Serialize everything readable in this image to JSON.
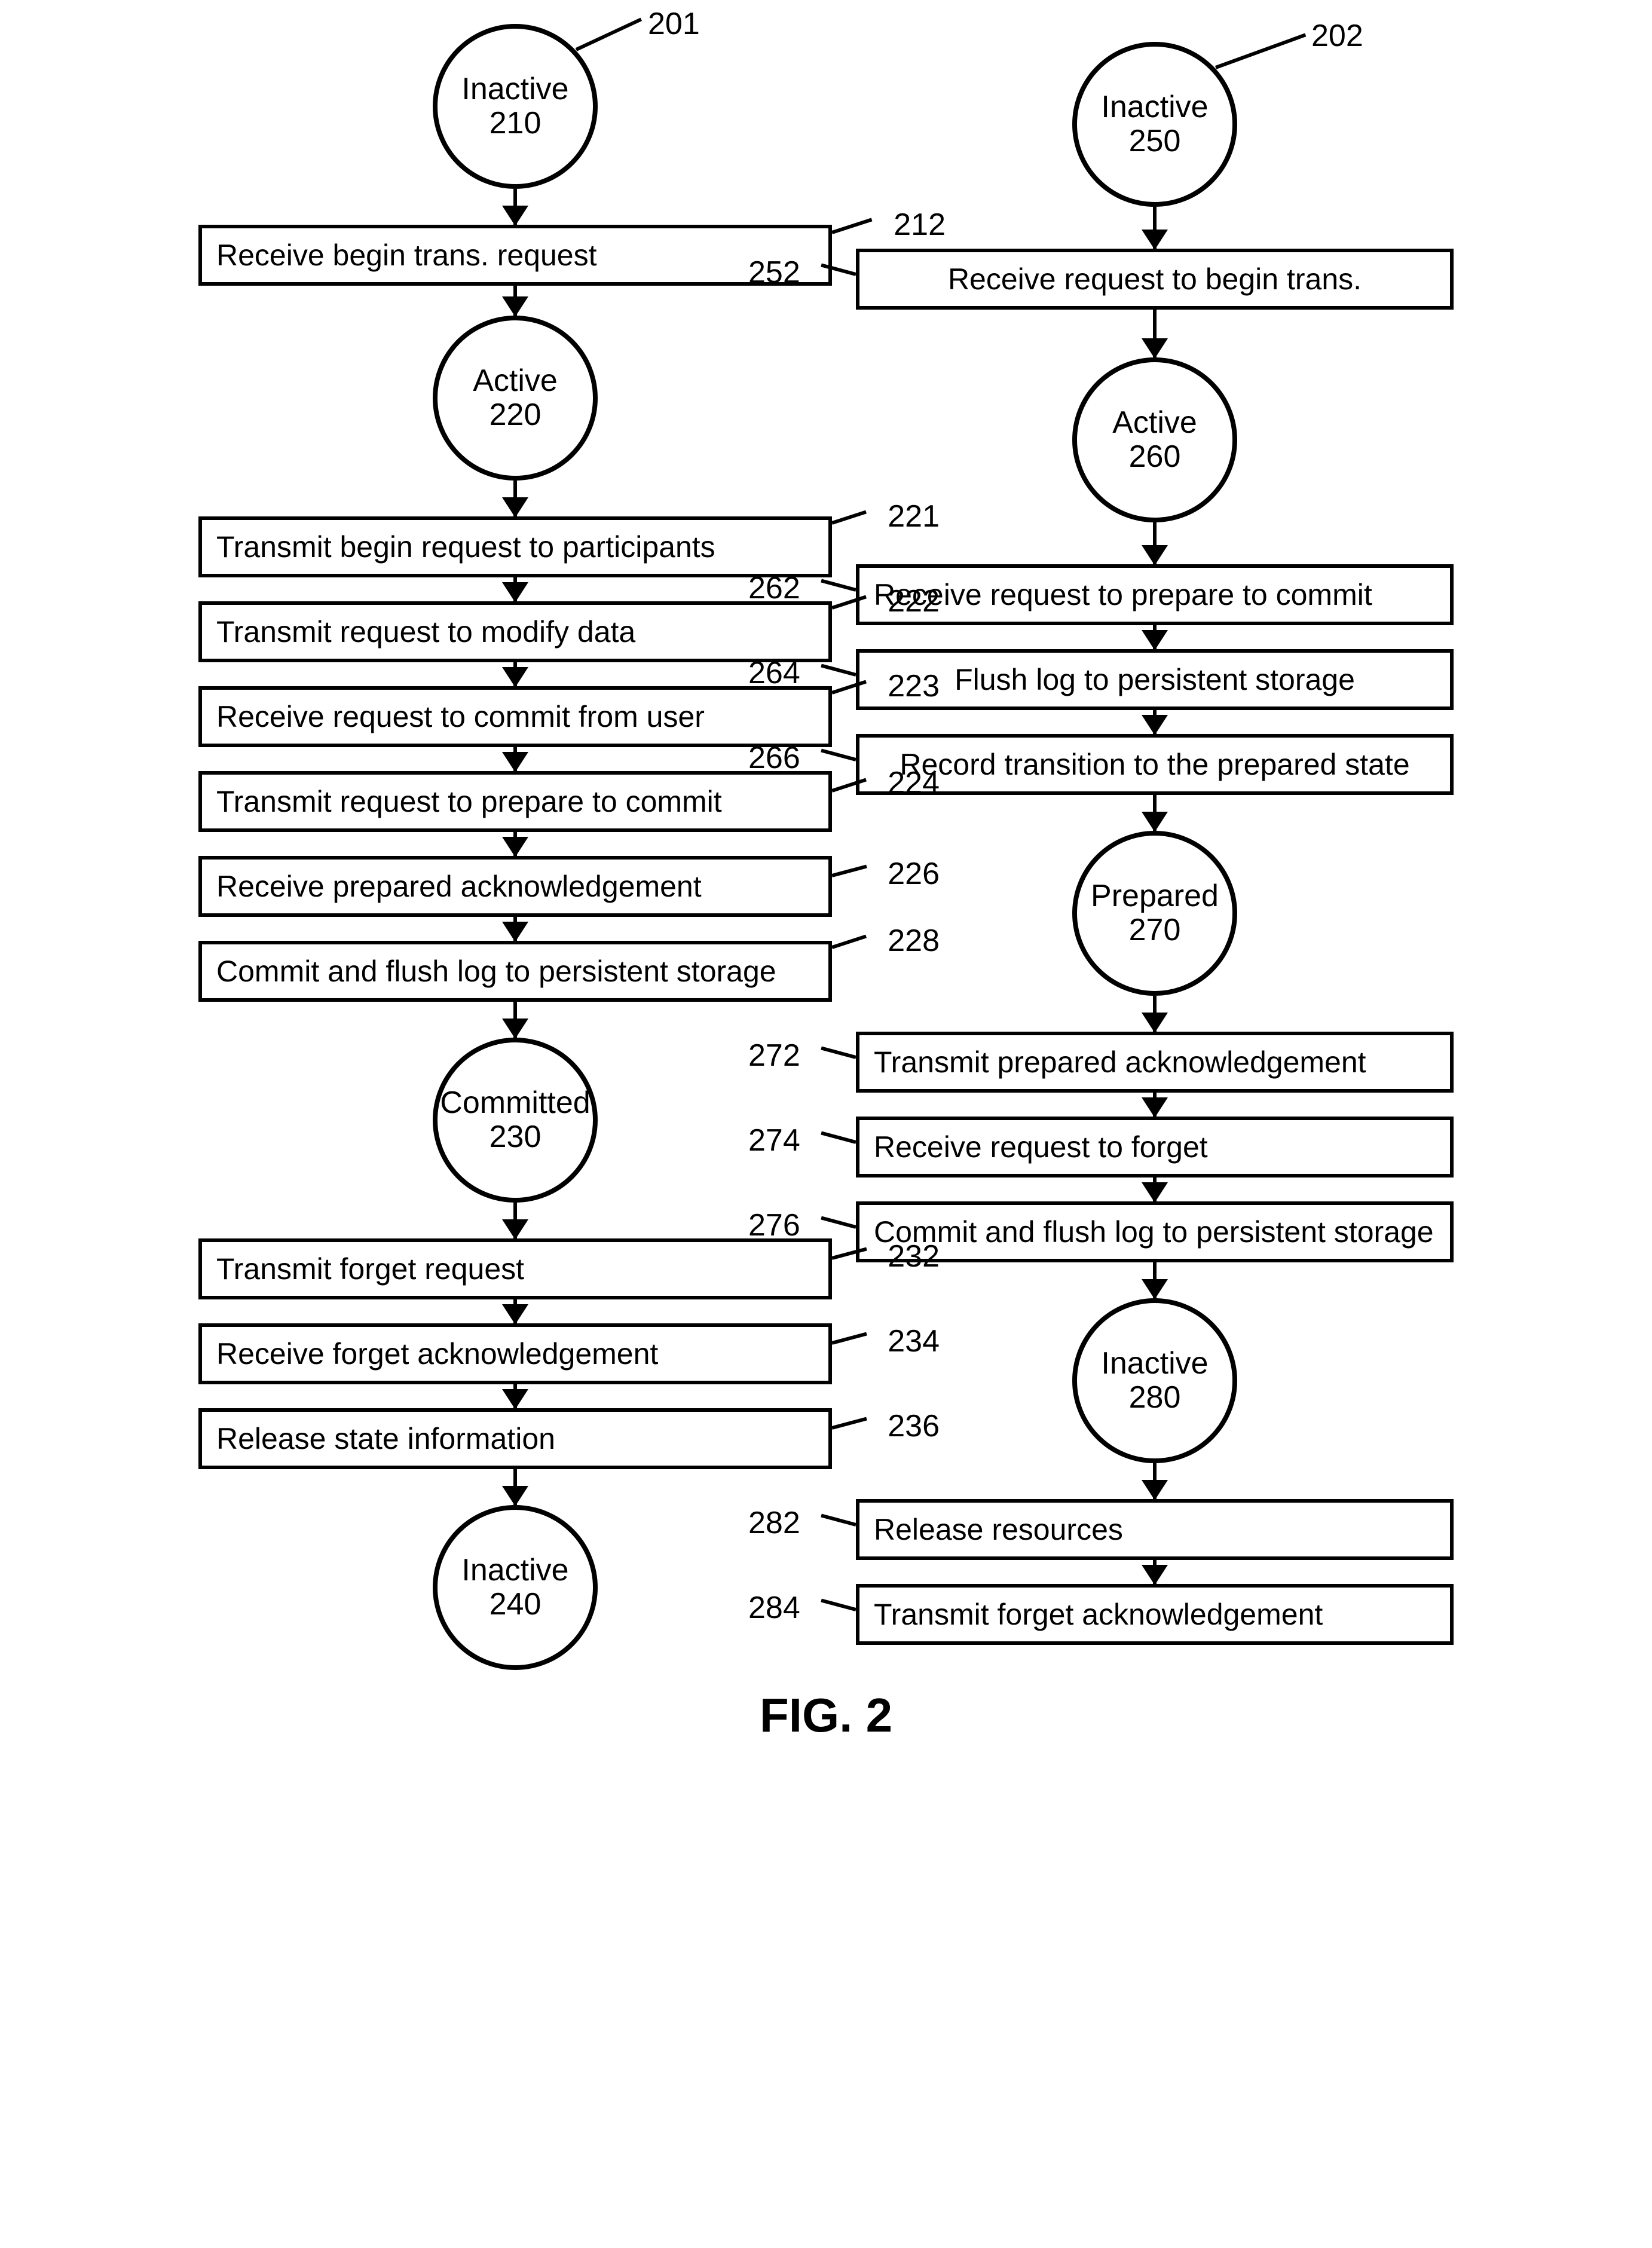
{
  "figure_label": "FIG. 2",
  "left": {
    "ref_top": "201",
    "state_inactive1": {
      "label": "Inactive",
      "num": "210"
    },
    "step212": {
      "text": "Receive begin trans. request",
      "ref": "212"
    },
    "state_active": {
      "label": "Active",
      "num": "220"
    },
    "step221": {
      "text": "Transmit begin request to participants",
      "ref": "221"
    },
    "step222": {
      "text": "Transmit request to modify data",
      "ref": "222"
    },
    "step223": {
      "text": "Receive request to commit from user",
      "ref": "223"
    },
    "step224": {
      "text": "Transmit request to prepare to commit",
      "ref": "224"
    },
    "step226": {
      "text": "Receive prepared acknowledgement",
      "ref": "226"
    },
    "step228": {
      "text": "Commit and flush log to persistent storage",
      "ref": "228"
    },
    "state_committed": {
      "label": "Committed",
      "num": "230"
    },
    "step232": {
      "text": "Transmit forget request",
      "ref": "232"
    },
    "step234": {
      "text": "Receive forget acknowledgement",
      "ref": "234"
    },
    "step236": {
      "text": "Release state information",
      "ref": "236"
    },
    "state_inactive2": {
      "label": "Inactive",
      "num": "240"
    }
  },
  "right": {
    "ref_top": "202",
    "state_inactive1": {
      "label": "Inactive",
      "num": "250"
    },
    "step252": {
      "text": "Receive request to begin trans.",
      "ref": "252"
    },
    "state_active": {
      "label": "Active",
      "num": "260"
    },
    "step262": {
      "text": "Receive request to prepare to commit",
      "ref": "262"
    },
    "step264": {
      "text": "Flush log to persistent storage",
      "ref": "264"
    },
    "step266": {
      "text": "Record transition to the prepared state",
      "ref": "266"
    },
    "state_prepared": {
      "label": "Prepared",
      "num": "270"
    },
    "step272": {
      "text": "Transmit prepared acknowledgement",
      "ref": "272"
    },
    "step274": {
      "text": "Receive request to forget",
      "ref": "274"
    },
    "step276": {
      "text": "Commit and flush log to persistent storage",
      "ref": "276"
    },
    "state_inactive2": {
      "label": "Inactive",
      "num": "280"
    },
    "step282": {
      "text": "Release resources",
      "ref": "282"
    },
    "step284": {
      "text": "Transmit forget acknowledgement",
      "ref": "284"
    }
  }
}
